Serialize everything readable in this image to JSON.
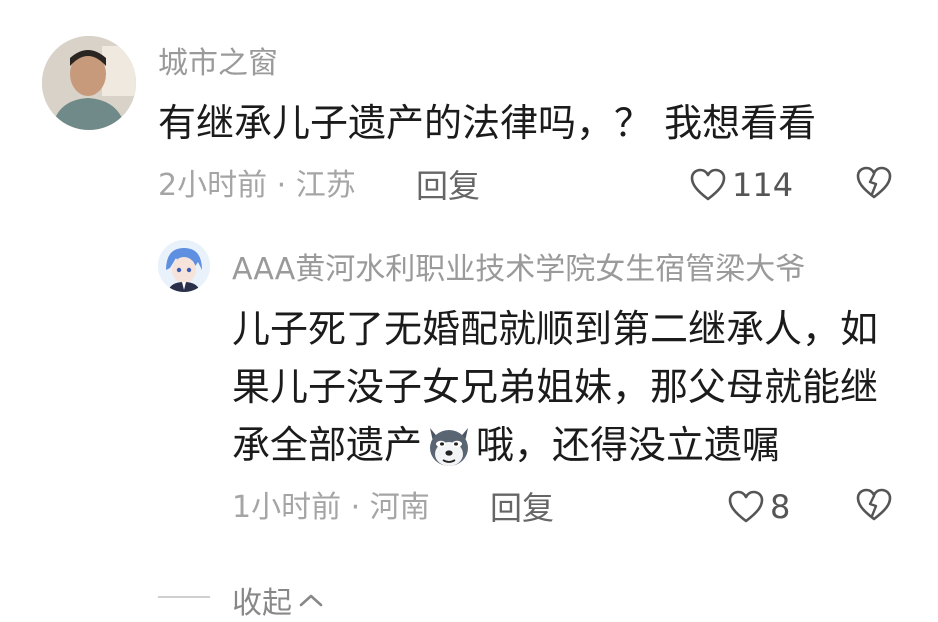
{
  "comment": {
    "username": "城市之窗",
    "text": "有继承儿子遗产的法律吗，？ 我想看看",
    "time_location": "2小时前 · 江苏",
    "reply_label": "回复",
    "like_count": "114",
    "avatar_icon": "avatar-photo",
    "like_icon": "heart-outline-icon",
    "dislike_icon": "broken-heart-icon"
  },
  "reply": {
    "username": "AAA黄河水利职业技术学院女生宿管梁大爷",
    "line1": "儿子死了无婚配就顺到第二继承人，如",
    "line2": "果儿子没子女兄弟姐妹，那父母就能继",
    "line3_before": "承全部遗产",
    "line3_after": "哦，还得没立遗嘱",
    "emoji_icon": "dog-emoji-icon",
    "time_location": "1小时前 · 河南",
    "reply_label": "回复",
    "like_count": "8",
    "avatar_icon": "anime-avatar",
    "like_icon": "heart-outline-icon",
    "dislike_icon": "broken-heart-icon"
  },
  "collapse_label": "收起"
}
